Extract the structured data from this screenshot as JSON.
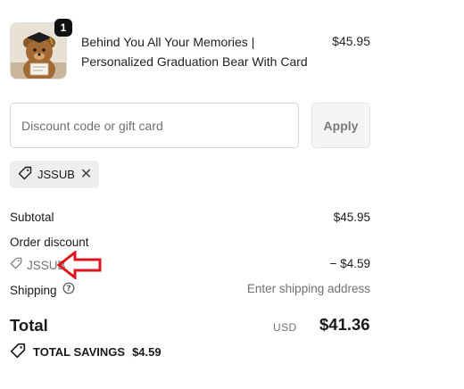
{
  "line_item": {
    "quantity": "1",
    "title_line1": "Behind You All Your Memories |",
    "title_line2": "Personalized Graduation Bear With Card",
    "price": "$45.95",
    "image_icon": "graduation-bear-icon"
  },
  "discount": {
    "placeholder": "Discount code or gift card",
    "value": "",
    "apply_label": "Apply",
    "applied_code": "JSSUB",
    "tag_icon": "tag-icon",
    "remove_icon": "close-icon"
  },
  "summary": {
    "subtotal_label": "Subtotal",
    "subtotal_value": "$45.95",
    "order_discount_label": "Order discount",
    "order_discount_code": "JSSUB",
    "order_discount_value": "− $4.59",
    "shipping_label": "Shipping",
    "shipping_value": "Enter shipping address",
    "shipping_help_icon": "help-circle-icon"
  },
  "total": {
    "label": "Total",
    "currency": "USD",
    "amount": "$41.36"
  },
  "savings": {
    "label": "TOTAL SAVINGS",
    "amount": "$4.59"
  },
  "annotation": {
    "arrow_color": "#e0141e"
  }
}
